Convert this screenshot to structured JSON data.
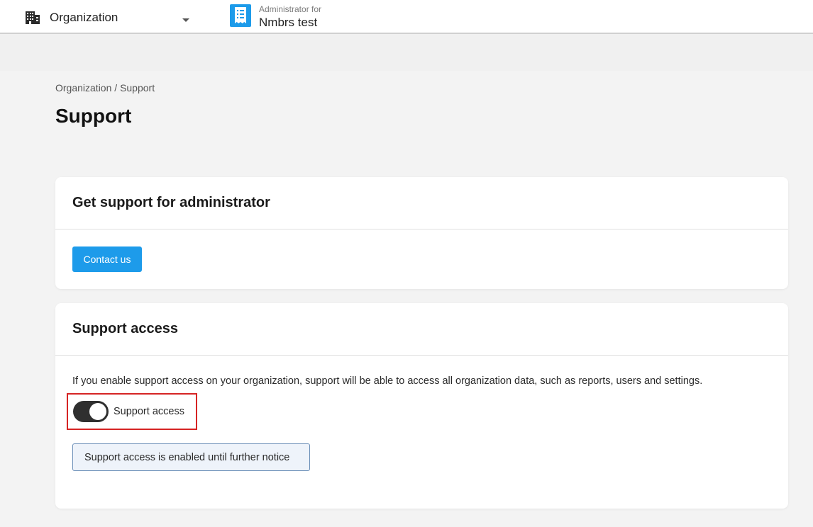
{
  "topbar": {
    "org_selector": {
      "label": "Organization",
      "icon": "building-icon"
    },
    "admin": {
      "caption": "Administrator for",
      "name": "Nmbrs test",
      "icon": "receipt-icon"
    }
  },
  "breadcrumb": {
    "items": [
      "Organization",
      "Support"
    ],
    "separator": "/"
  },
  "page_title": "Support",
  "cards": {
    "admin_support": {
      "title": "Get support for administrator",
      "button_label": "Contact us"
    },
    "support_access": {
      "title": "Support access",
      "description": "If you enable support access on your organization, support will be able to access all organization data, such as reports, users and settings.",
      "toggle_label": "Support access",
      "toggle_on": true,
      "status": "Support access is enabled until further notice"
    }
  },
  "colors": {
    "accent": "#1d9bea",
    "toggle_on": "#2f2f2f",
    "highlight_border": "#d62424",
    "notice_border": "#6b8fb8",
    "notice_bg": "#eef3fa"
  }
}
